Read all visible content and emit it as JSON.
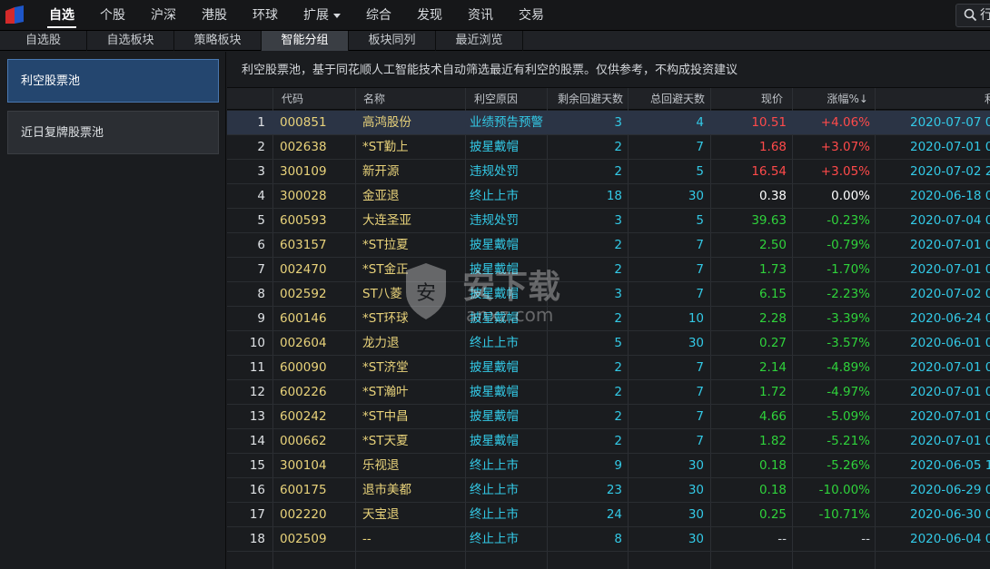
{
  "nav": {
    "items": [
      {
        "label": "自选",
        "active": true
      },
      {
        "label": "个股"
      },
      {
        "label": "沪深"
      },
      {
        "label": "港股"
      },
      {
        "label": "环球"
      },
      {
        "label": "扩展",
        "caret": true
      },
      {
        "label": "综合"
      },
      {
        "label": "发现"
      },
      {
        "label": "资讯"
      },
      {
        "label": "交易"
      }
    ],
    "search_label": "行"
  },
  "subtabs": [
    {
      "label": "自选股"
    },
    {
      "label": "自选板块"
    },
    {
      "label": "策略板块"
    },
    {
      "label": "智能分组",
      "active": true
    },
    {
      "label": "板块同列"
    },
    {
      "label": "最近浏览"
    }
  ],
  "sidebar": {
    "pools": [
      {
        "label": "利空股票池",
        "active": true
      },
      {
        "label": "近日复牌股票池"
      }
    ]
  },
  "description": "利空股票池，基于同花顺人工智能技术自动筛选最近有利空的股票。仅供参考，不构成投资建议",
  "table": {
    "headers": {
      "code": "代码",
      "name": "名称",
      "reason": "利空原因",
      "remain": "剩余回避天数",
      "total": "总回避天数",
      "price": "现价",
      "change": "涨幅%↓",
      "date": "利"
    },
    "rows": [
      {
        "idx": "1",
        "code": "000851",
        "name": "高鸿股份",
        "reason": "业绩预告预警",
        "remain": "3",
        "total": "4",
        "price": "10.51",
        "change": "+4.06%",
        "date": "2020-07-07 0",
        "trend": "up",
        "selected": true
      },
      {
        "idx": "2",
        "code": "002638",
        "name": "*ST勤上",
        "reason": "披星戴帽",
        "remain": "2",
        "total": "7",
        "price": "1.68",
        "change": "+3.07%",
        "date": "2020-07-01 0",
        "trend": "up"
      },
      {
        "idx": "3",
        "code": "300109",
        "name": "新开源",
        "reason": "违规处罚",
        "remain": "2",
        "total": "5",
        "price": "16.54",
        "change": "+3.05%",
        "date": "2020-07-02 2",
        "trend": "up"
      },
      {
        "idx": "4",
        "code": "300028",
        "name": "金亚退",
        "reason": "终止上市",
        "remain": "18",
        "total": "30",
        "price": "0.38",
        "change": "0.00%",
        "date": "2020-06-18 0",
        "trend": "flat"
      },
      {
        "idx": "5",
        "code": "600593",
        "name": "大连圣亚",
        "reason": "违规处罚",
        "remain": "3",
        "total": "5",
        "price": "39.63",
        "change": "-0.23%",
        "date": "2020-07-04 0",
        "trend": "down"
      },
      {
        "idx": "6",
        "code": "603157",
        "name": "*ST拉夏",
        "reason": "披星戴帽",
        "remain": "2",
        "total": "7",
        "price": "2.50",
        "change": "-0.79%",
        "date": "2020-07-01 0",
        "trend": "down"
      },
      {
        "idx": "7",
        "code": "002470",
        "name": "*ST金正",
        "reason": "披星戴帽",
        "remain": "2",
        "total": "7",
        "price": "1.73",
        "change": "-1.70%",
        "date": "2020-07-01 0",
        "trend": "down"
      },
      {
        "idx": "8",
        "code": "002592",
        "name": "ST八菱",
        "reason": "披星戴帽",
        "remain": "3",
        "total": "7",
        "price": "6.15",
        "change": "-2.23%",
        "date": "2020-07-02 0",
        "trend": "down"
      },
      {
        "idx": "9",
        "code": "600146",
        "name": "*ST环球",
        "reason": "披星戴帽",
        "remain": "2",
        "total": "10",
        "price": "2.28",
        "change": "-3.39%",
        "date": "2020-06-24 0",
        "trend": "down"
      },
      {
        "idx": "10",
        "code": "002604",
        "name": "龙力退",
        "reason": "终止上市",
        "remain": "5",
        "total": "30",
        "price": "0.27",
        "change": "-3.57%",
        "date": "2020-06-01 0",
        "trend": "down"
      },
      {
        "idx": "11",
        "code": "600090",
        "name": "*ST济堂",
        "reason": "披星戴帽",
        "remain": "2",
        "total": "7",
        "price": "2.14",
        "change": "-4.89%",
        "date": "2020-07-01 0",
        "trend": "down"
      },
      {
        "idx": "12",
        "code": "600226",
        "name": "*ST瀚叶",
        "reason": "披星戴帽",
        "remain": "2",
        "total": "7",
        "price": "1.72",
        "change": "-4.97%",
        "date": "2020-07-01 0",
        "trend": "down"
      },
      {
        "idx": "13",
        "code": "600242",
        "name": "*ST中昌",
        "reason": "披星戴帽",
        "remain": "2",
        "total": "7",
        "price": "4.66",
        "change": "-5.09%",
        "date": "2020-07-01 0",
        "trend": "down"
      },
      {
        "idx": "14",
        "code": "000662",
        "name": "*ST天夏",
        "reason": "披星戴帽",
        "remain": "2",
        "total": "7",
        "price": "1.82",
        "change": "-5.21%",
        "date": "2020-07-01 0",
        "trend": "down"
      },
      {
        "idx": "15",
        "code": "300104",
        "name": "乐视退",
        "reason": "终止上市",
        "remain": "9",
        "total": "30",
        "price": "0.18",
        "change": "-5.26%",
        "date": "2020-06-05 1",
        "trend": "down"
      },
      {
        "idx": "16",
        "code": "600175",
        "name": "退市美都",
        "reason": "终止上市",
        "remain": "23",
        "total": "30",
        "price": "0.18",
        "change": "-10.00%",
        "date": "2020-06-29 0",
        "trend": "down"
      },
      {
        "idx": "17",
        "code": "002220",
        "name": "天宝退",
        "reason": "终止上市",
        "remain": "24",
        "total": "30",
        "price": "0.25",
        "change": "-10.71%",
        "date": "2020-06-30 0",
        "trend": "down"
      },
      {
        "idx": "18",
        "code": "002509",
        "name": "--",
        "reason": "终止上市",
        "remain": "8",
        "total": "30",
        "price": "--",
        "change": "--",
        "date": "2020-06-04 0",
        "trend": "none"
      }
    ]
  },
  "watermark": {
    "text": "安下载",
    "sub": "anxz.com",
    "badge": "安"
  },
  "colors": {
    "up": "#ff4a4a",
    "down": "#2fd23b",
    "cyan": "#33c9e6",
    "yellow": "#e8d27a",
    "selected_pool": "#24466f"
  }
}
